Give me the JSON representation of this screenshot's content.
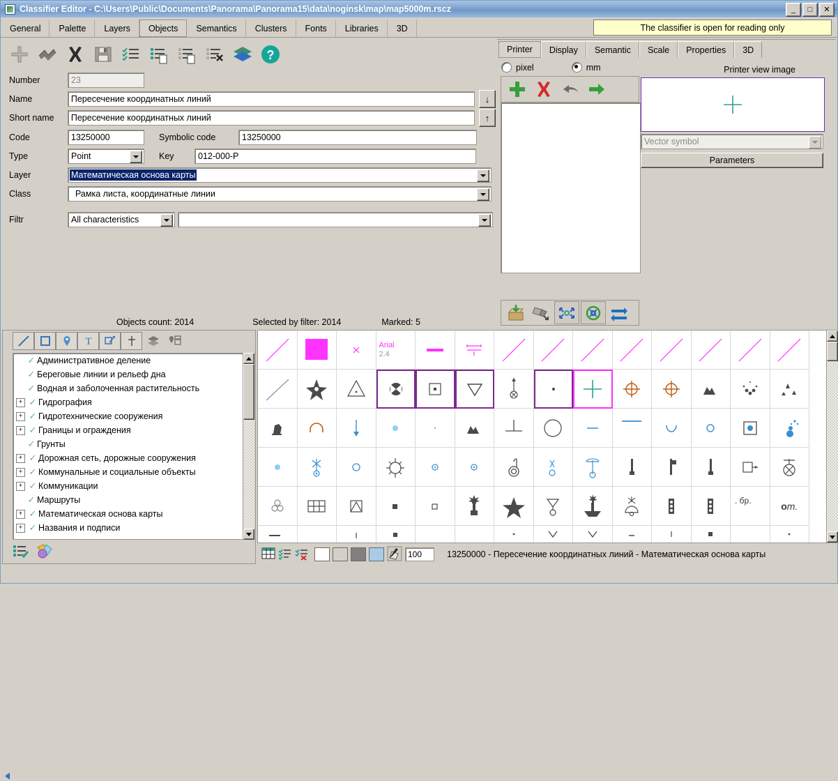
{
  "window": {
    "title": "Classifier Editor - C:\\Users\\Public\\Documents\\Panorama\\Panorama15\\data\\noginsk\\map\\map5000m.rscz",
    "minimize": "_",
    "maximize": "□",
    "close": "✕"
  },
  "menu": {
    "tabs": [
      {
        "label": "General",
        "selected": false
      },
      {
        "label": "Palette",
        "selected": false
      },
      {
        "label": "Layers",
        "selected": false
      },
      {
        "label": "Objects",
        "selected": true
      },
      {
        "label": "Semantics",
        "selected": false
      },
      {
        "label": "Clusters",
        "selected": false
      },
      {
        "label": "Fonts",
        "selected": false
      },
      {
        "label": "Libraries",
        "selected": false
      },
      {
        "label": "3D",
        "selected": false
      }
    ],
    "notice": "The classifier is open for reading only"
  },
  "toolbar": {
    "items": [
      {
        "name": "add-object-icon",
        "title": "Add"
      },
      {
        "name": "copy-object-icon",
        "title": "Copy"
      },
      {
        "name": "delete-object-icon",
        "title": "Delete"
      },
      {
        "name": "save-icon",
        "title": "Save"
      },
      {
        "name": "checklist-icon",
        "title": "Select all"
      },
      {
        "name": "copy-list-icon",
        "title": "Copy list"
      },
      {
        "name": "paste-list-icon",
        "title": "Paste list"
      },
      {
        "name": "clear-list-icon",
        "title": "Clear list"
      },
      {
        "name": "layers-icon",
        "title": "Layers"
      },
      {
        "name": "help-icon",
        "title": "Help"
      }
    ]
  },
  "form": {
    "number": {
      "label": "Number",
      "value": "23"
    },
    "name": {
      "label": "Name",
      "value": "Пересечение координатных линий"
    },
    "short_name": {
      "label": "Short name",
      "value": "Пересечение координатных линий"
    },
    "code": {
      "label": "Code",
      "value": "13250000"
    },
    "symbolic_code": {
      "label": "Symbolic code",
      "value": "13250000"
    },
    "type": {
      "label": "Type",
      "value": "Point"
    },
    "key": {
      "label": "Key",
      "value": "012-000-P"
    },
    "layer": {
      "label": "Layer",
      "value": "Математическая основа карты"
    },
    "class": {
      "label": "Class",
      "value": "Рамка листа, координатные линии"
    },
    "filtr": {
      "label": "Filtr",
      "value": "All characteristics",
      "value2": ""
    },
    "move_down_button": "↓",
    "move_up_button": "↑"
  },
  "counts": {
    "objects_count": "Objects count: 2014",
    "selected_by_filter": "Selected by filter: 2014",
    "marked": "Marked: 5"
  },
  "right_panel": {
    "tabs": [
      {
        "label": "Printer",
        "selected": true
      },
      {
        "label": "Display",
        "selected": false
      },
      {
        "label": "Semantic",
        "selected": false
      },
      {
        "label": "Scale",
        "selected": false
      },
      {
        "label": "Properties",
        "selected": false
      },
      {
        "label": "3D",
        "selected": false
      }
    ],
    "units": [
      {
        "label": "pixel",
        "checked": false
      },
      {
        "label": "mm",
        "checked": true
      }
    ],
    "preview_title": "Printer view image",
    "vector_symbol_placeholder": "Vector symbol",
    "parameters_button": "Parameters",
    "sym_tools": [
      {
        "name": "add-symbol-icon"
      },
      {
        "name": "delete-symbol-icon"
      },
      {
        "name": "undo-icon"
      },
      {
        "name": "apply-icon"
      }
    ],
    "bottom_tools": [
      {
        "name": "import-box-icon",
        "active": false
      },
      {
        "name": "export-box-icon",
        "active": false
      },
      {
        "name": "fit-expand-icon",
        "active": true
      },
      {
        "name": "fit-shrink-icon",
        "active": true
      },
      {
        "name": "swap-arrows-icon",
        "active": false
      }
    ]
  },
  "tree": {
    "tools": [
      {
        "name": "line-type-icon",
        "selected": true
      },
      {
        "name": "square-type-icon",
        "selected": true
      },
      {
        "name": "point-type-icon",
        "selected": true
      },
      {
        "name": "text-type-icon",
        "selected": true
      },
      {
        "name": "vector-type-icon",
        "selected": true
      },
      {
        "name": "template-type-icon",
        "selected": true
      },
      {
        "name": "layers-stack-icon",
        "selected": false
      },
      {
        "name": "object-group-icon",
        "selected": false
      }
    ],
    "items": [
      {
        "label": "Административное деление",
        "expandable": false
      },
      {
        "label": "Береговые линии и рельеф дна",
        "expandable": false
      },
      {
        "label": "Водная и заболоченная растительность",
        "expandable": false
      },
      {
        "label": "Гидрография",
        "expandable": true
      },
      {
        "label": "Гидротехнические сооружения",
        "expandable": true
      },
      {
        "label": "Границы и ограждения",
        "expandable": true
      },
      {
        "label": "Грунты",
        "expandable": false
      },
      {
        "label": "Дорожная сеть, дорожные сооружения",
        "expandable": true
      },
      {
        "label": "Коммунальные и социальные объекты",
        "expandable": true
      },
      {
        "label": "Коммуникации",
        "expandable": true
      },
      {
        "label": "Маршруты",
        "expandable": false
      },
      {
        "label": "Математическая основа карты",
        "expandable": true
      },
      {
        "label": "Названия и подписи",
        "expandable": true
      }
    ],
    "bottom_tools": [
      {
        "name": "check-list-icon"
      },
      {
        "name": "palette-icon"
      }
    ]
  },
  "symbol_grid": {
    "font_sample": {
      "family": "Arial",
      "size": "2.4"
    },
    "selected_cells": [
      [
        1,
        3
      ],
      [
        1,
        4
      ],
      [
        1,
        5
      ],
      [
        1,
        7
      ],
      [
        1,
        8
      ]
    ],
    "active_cell": [
      1,
      8
    ]
  },
  "status_bar": {
    "zoom": "100",
    "text": "13250000 - Пересечение координатных линий - Математическая основа карты",
    "swatches": [
      "#ffffff",
      "#d4d0c8",
      "#808080",
      "#a8cbe8"
    ],
    "icons": [
      {
        "name": "table-grid-icon"
      },
      {
        "name": "check-list-icon"
      },
      {
        "name": "clear-list-icon"
      },
      {
        "name": "pen-icon"
      }
    ]
  },
  "colors": {
    "face": "#d4d0c8",
    "magenta": "#ff33ff",
    "teal": "#2f9e8f",
    "select_purple": "#7b2a8c",
    "highlight_blue": "#0a246a",
    "notice_yellow": "#ffffcc"
  }
}
